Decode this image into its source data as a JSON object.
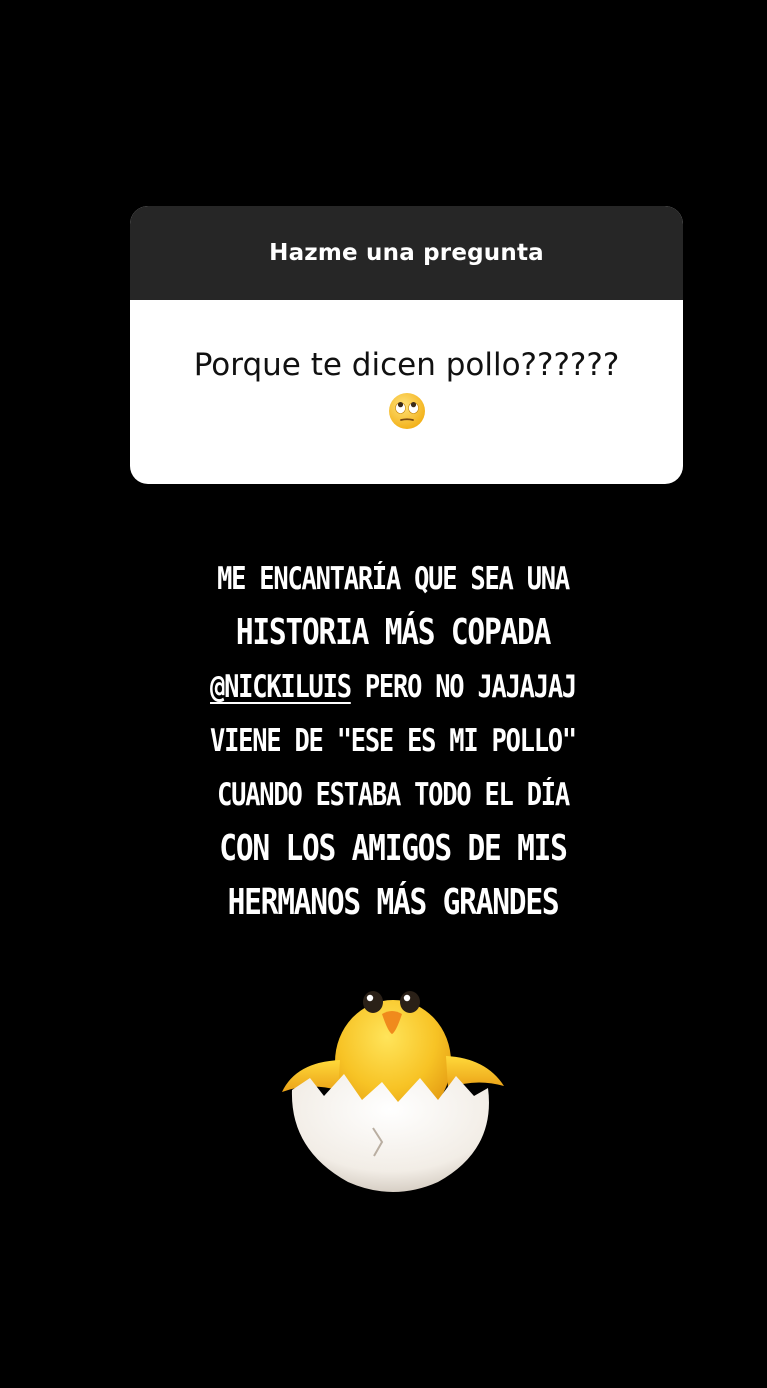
{
  "question_sticker": {
    "header_label": "Hazme una pregunta",
    "question": "Porque te dicen pollo??????",
    "question_emoji_icon": "face-with-rolling-eyes-icon"
  },
  "answer": {
    "lines": [
      "ME ENCANTARÍA QUE SEA UNA",
      "HISTORIA MÁS COPADA",
      "PERO NO JAJAJAJ",
      "VIENE DE \"ESE ES MI POLLO\"",
      "CUANDO ESTABA TODO EL DÍA",
      "CON LOS AMIGOS DE MIS",
      "HERMANOS MÁS GRANDES"
    ],
    "mention": "@NICKILUIS"
  },
  "sticker_icon": "hatching-chick-icon",
  "colors": {
    "background": "#000000",
    "card_header": "#262626",
    "card_body": "#ffffff",
    "text_on_dark": "#ffffff",
    "chick_yellow": "#f7c325"
  }
}
